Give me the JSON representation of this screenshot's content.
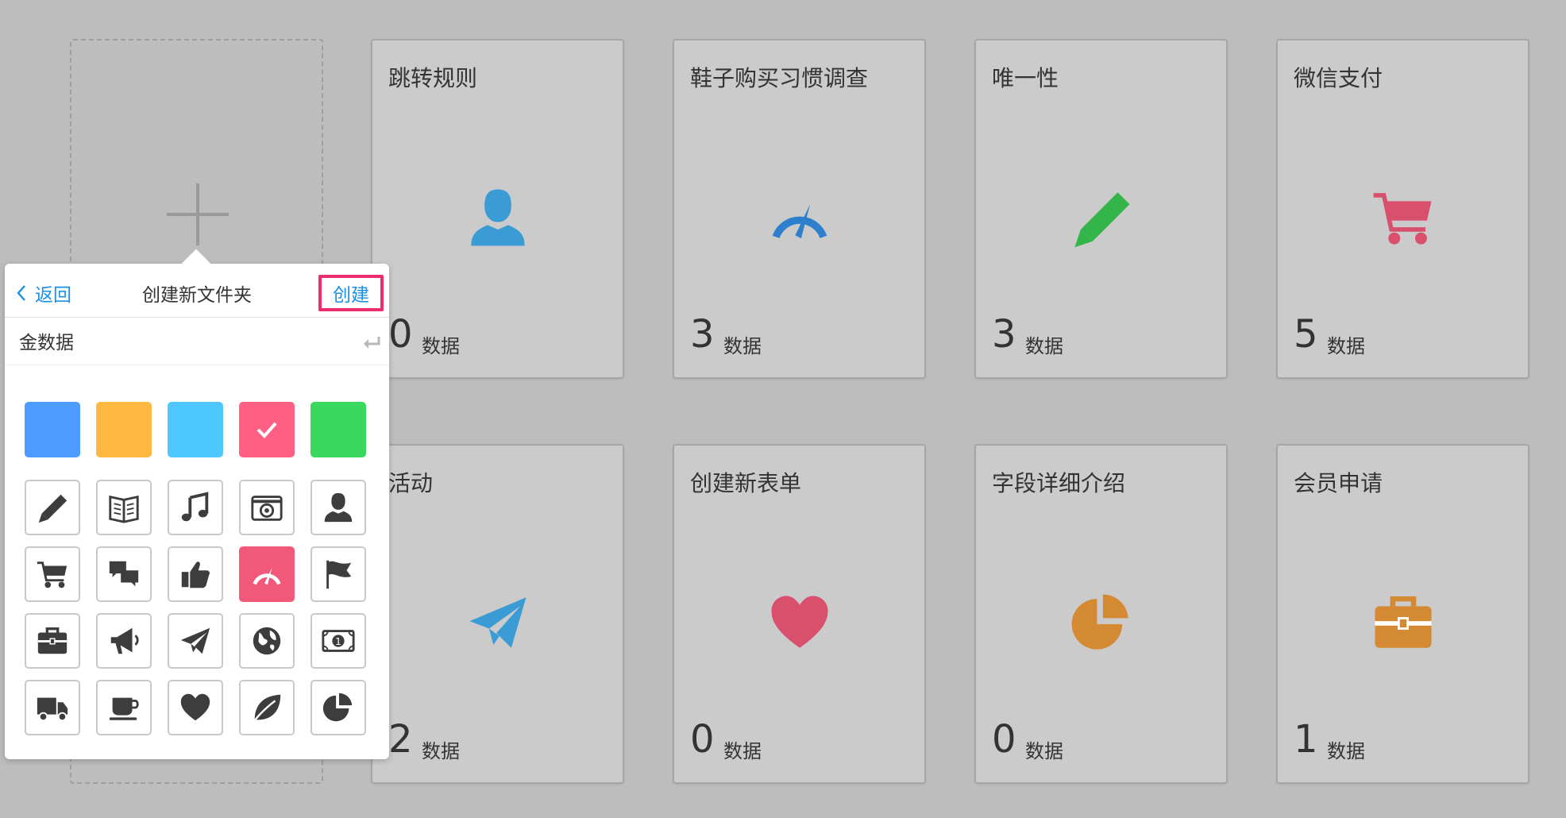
{
  "cards": [
    {
      "title": "跳转规则",
      "count": "0",
      "unit": "数据",
      "icon": "user-icon",
      "color": "#3a9bd5"
    },
    {
      "title": "鞋子购买习惯调查",
      "count": "3",
      "unit": "数据",
      "icon": "speedometer-icon",
      "color": "#2f7fcf"
    },
    {
      "title": "唯一性",
      "count": "3",
      "unit": "数据",
      "icon": "pencil-icon",
      "color": "#33b54a"
    },
    {
      "title": "微信支付",
      "count": "5",
      "unit": "数据",
      "icon": "cart-icon",
      "color": "#d9506c"
    },
    {
      "title": "活动",
      "count": "2",
      "unit": "数据",
      "icon": "paper-plane-icon",
      "color": "#3a9bd5"
    },
    {
      "title": "创建新表单",
      "count": "0",
      "unit": "数据",
      "icon": "heart-icon",
      "color": "#d9506c"
    },
    {
      "title": "字段详细介绍",
      "count": "0",
      "unit": "数据",
      "icon": "pie-chart-icon",
      "color": "#d48a33"
    },
    {
      "title": "会员申请",
      "count": "1",
      "unit": "数据",
      "icon": "briefcase-icon",
      "color": "#d48a33"
    }
  ],
  "popover": {
    "back_label": "返回",
    "title": "创建新文件夹",
    "create_label": "创建",
    "name_value": "金数据",
    "colors": [
      "#4d9bff",
      "#ffb840",
      "#4fc7ff",
      "#ff5f82",
      "#3ad85e"
    ],
    "selected_color_index": 3,
    "icons": [
      "pencil-icon",
      "book-icon",
      "music-icon",
      "camera-icon",
      "user-icon",
      "cart-icon",
      "chat-icon",
      "thumbs-up-icon",
      "speedometer-icon",
      "flag-icon",
      "briefcase-icon",
      "megaphone-icon",
      "paper-plane-icon",
      "globe-icon",
      "money-icon",
      "truck-icon",
      "coffee-icon",
      "heart-icon",
      "leaf-icon",
      "pie-chart-icon"
    ],
    "selected_icon": "speedometer-icon"
  }
}
